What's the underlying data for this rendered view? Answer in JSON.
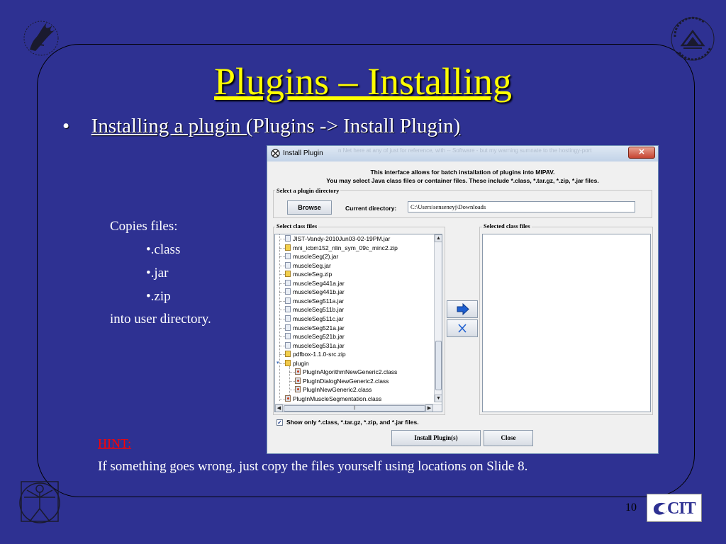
{
  "slide": {
    "title": "Plugins – Installing",
    "bullet_marker": "•",
    "bullet_main": "Installing a plugin (",
    "bullet_menu": "Plugins -> Install Plugin",
    "bullet_close": ")",
    "copies_label": "Copies files:",
    "file_types": [
      "•.class",
      "•.jar",
      "•.zip"
    ],
    "destination": "into user directory.",
    "hint_label": "HINT:",
    "hint_text": "If something goes wrong, just copy the files yourself using locations on Slide 8.",
    "page_number": "10",
    "cit_logo_text": "CIT"
  },
  "dialog": {
    "title": "Install Plugin",
    "close_glyph": "✕",
    "background_text": "n  Net here at any of just for reference, with   --  Software - but my warning sumnate to the hostingy-port",
    "info_line1": "This interface allows for batch installation of plugins into MIPAV.",
    "info_line2": "You may select Java class files or container files. These include *.class, *.tar.gz, *.zip, *.jar files.",
    "dir_group_label": "Select a plugin directory",
    "browse_label": "Browse",
    "current_dir_label": "Current directory:",
    "current_dir_value": "C:\\Users\\senseneyj\\Downloads",
    "class_files_label": "Select class files",
    "selected_files_label": "Selected class files",
    "add_icon": "add-arrow-icon",
    "remove_icon": "remove-x-icon",
    "remove_glyph": "✕",
    "checkbox_checked": true,
    "checkbox_glyph": "✓",
    "checkbox_label": "Show only *.class, *.tar.gz, *.zip, and *.jar files.",
    "install_button": "Install Plugin(s)",
    "close_button": "Close",
    "scroll_up": "▲",
    "scroll_down": "▼",
    "scroll_left": "◀",
    "scroll_right": "▶",
    "scroll_grip": "||",
    "file_tree": [
      {
        "name": "JIST-Vandy-2010Jun03-02-19PM.jar",
        "icon": "jar",
        "depth": 1
      },
      {
        "name": "mni_icbm152_nlin_sym_09c_minc2.zip",
        "icon": "zip",
        "depth": 1
      },
      {
        "name": "muscleSeg(2).jar",
        "icon": "jar",
        "depth": 1
      },
      {
        "name": "muscleSeg.jar",
        "icon": "jar",
        "depth": 1
      },
      {
        "name": "muscleSeg.zip",
        "icon": "zip",
        "depth": 1
      },
      {
        "name": "muscleSeg441a.jar",
        "icon": "jar",
        "depth": 1
      },
      {
        "name": "muscleSeg441b.jar",
        "icon": "jar",
        "depth": 1
      },
      {
        "name": "muscleSeg511a.jar",
        "icon": "jar",
        "depth": 1
      },
      {
        "name": "muscleSeg511b.jar",
        "icon": "jar",
        "depth": 1
      },
      {
        "name": "muscleSeg511c.jar",
        "icon": "jar",
        "depth": 1
      },
      {
        "name": "muscleSeg521a.jar",
        "icon": "jar",
        "depth": 1
      },
      {
        "name": "muscleSeg521b.jar",
        "icon": "jar",
        "depth": 1
      },
      {
        "name": "muscleSeg531a.jar",
        "icon": "jar",
        "depth": 1
      },
      {
        "name": "pdfbox-1.1.0-src.zip",
        "icon": "zip",
        "depth": 1
      },
      {
        "name": "plugin",
        "icon": "folder",
        "depth": 1
      },
      {
        "name": "PlugInAlgorithmNewGeneric2.class",
        "icon": "class",
        "depth": 2
      },
      {
        "name": "PlugInDialogNewGeneric2.class",
        "icon": "class",
        "depth": 2
      },
      {
        "name": "PlugInNewGeneric2.class",
        "icon": "class",
        "depth": 2
      },
      {
        "name": "PlugInMuscleSegmentation.class",
        "icon": "class",
        "depth": 1
      }
    ]
  }
}
